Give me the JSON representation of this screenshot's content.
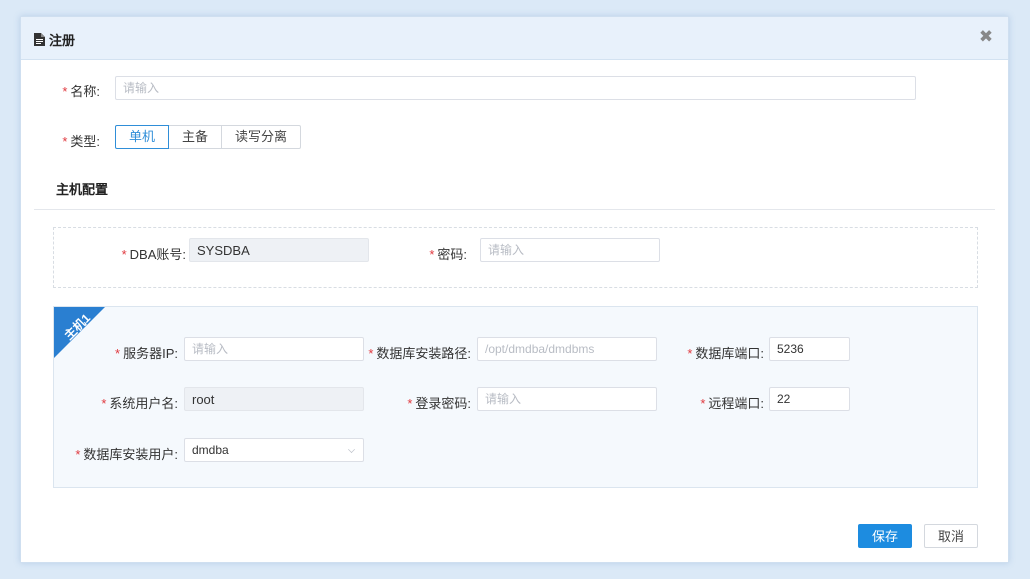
{
  "dialog": {
    "title": "注册",
    "icons": {
      "title": "document-icon",
      "close": "close-icon"
    }
  },
  "form": {
    "name": {
      "label": "名称:",
      "placeholder": "请输入",
      "value": ""
    },
    "type": {
      "label": "类型:",
      "options": [
        "单机",
        "主备",
        "读写分离"
      ],
      "selected": "单机"
    }
  },
  "host_config": {
    "title": "主机配置",
    "dba_account": {
      "label": "DBA账号:",
      "value": "SYSDBA"
    },
    "password": {
      "label": "密码:",
      "placeholder": "请输入"
    }
  },
  "host1": {
    "tag": "主机1",
    "server_ip": {
      "label": "服务器IP:",
      "placeholder": "请输入"
    },
    "install_path": {
      "label": "数据库安装路径:",
      "placeholder": "/opt/dmdba/dmdbms"
    },
    "db_port": {
      "label": "数据库端口:",
      "value": "5236"
    },
    "sys_user": {
      "label": "系统用户名:",
      "value": "root"
    },
    "login_password": {
      "label": "登录密码:",
      "placeholder": "请输入"
    },
    "remote_port": {
      "label": "远程端口:",
      "value": "22"
    },
    "install_user": {
      "label": "数据库安装用户:",
      "value": "dmdba"
    }
  },
  "footer": {
    "save": "保存",
    "cancel": "取消"
  },
  "colors": {
    "accent": "#1d8ce0",
    "required": "#e0383e",
    "ribbon": "#2a7fd1"
  }
}
